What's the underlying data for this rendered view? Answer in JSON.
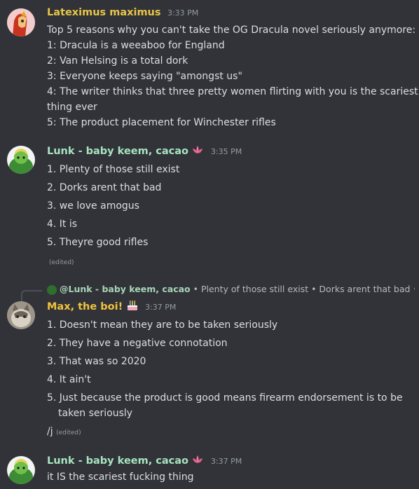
{
  "messages": [
    {
      "username": "Lateximus maximus",
      "username_color": "#e8c547",
      "timestamp": "3:33 PM",
      "lines": [
        "Top 5 reasons why you can't take the OG Dracula novel seriously anymore:",
        "1: Dracula is a weeaboo for England",
        "2: Van Helsing is a total dork",
        "3: Everyone keeps saying \"amongst us\"",
        "4: The writer thinks that three pretty women flirting with you is the scariest",
        "thing ever",
        "5: The product placement for Winchester rifles"
      ]
    },
    {
      "username": "Lunk - baby keem, cacao",
      "username_color": "#a8e4c0",
      "timestamp": "3:35 PM",
      "lines": [
        "1. Plenty of those still exist",
        "2. Dorks arent that bad",
        "3. we love amogus",
        "4. It is",
        "5. Theyre good rifles"
      ],
      "edited": "(edited)"
    },
    {
      "reply": {
        "username": "@Lunk - baby keem, cacao",
        "preview": "• Plenty of those still exist  • Dorks arent that bad  • w..."
      },
      "username": "Max, the boi!",
      "username_color": "#f0c33c",
      "timestamp": "3:37 PM",
      "lines": [
        "1. Doesn't mean they are to be taken seriously",
        "2. They have a negative connotation",
        "3. That was so 2020",
        "4. It ain't",
        "5. Just because the product is good means firearm endorsement is to be",
        "taken seriously"
      ],
      "last_line": "/j",
      "edited": "(edited)"
    },
    {
      "username": "Lunk - baby keem, cacao",
      "username_color": "#a8e4c0",
      "timestamp": "3:37 PM",
      "lines": [
        "it IS the scariest fucking thing"
      ]
    }
  ],
  "icons": {
    "lotus": "lotus-emoji",
    "cake": "birthday-cake-emoji"
  }
}
